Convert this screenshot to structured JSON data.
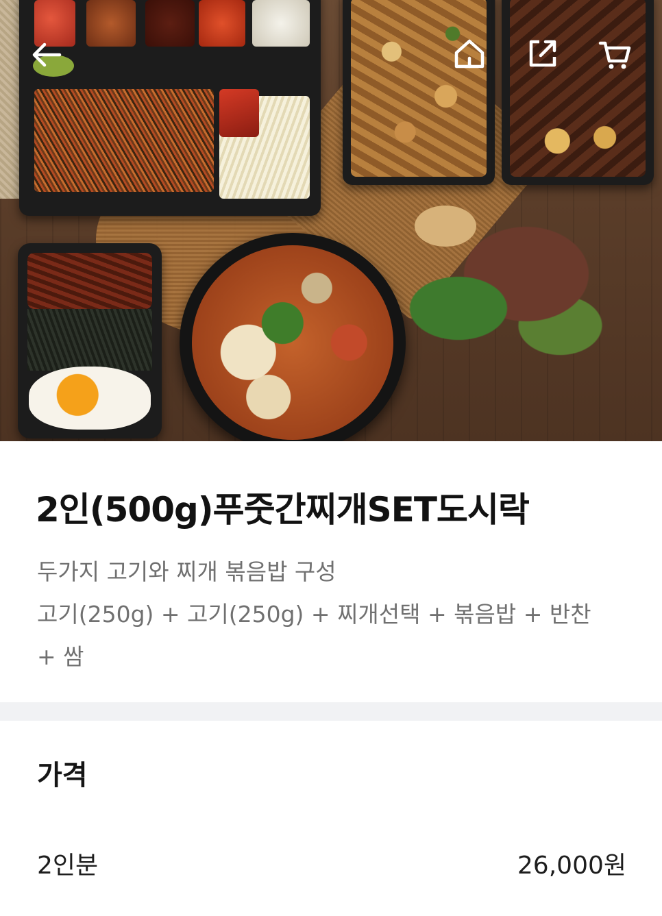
{
  "product": {
    "name": "2인(500g)푸줏간찌개SET도시락",
    "description_lines": [
      "두가지 고기와 찌개 볶음밥 구성",
      "고기(250g) + 고기(250g) + 찌개선택 + 볶음밥 + 반찬",
      "+ 쌈"
    ]
  },
  "header_icons": {
    "back": "back-arrow-icon",
    "home": "home-icon",
    "share": "share-icon",
    "cart": "cart-icon"
  },
  "price_section": {
    "heading": "가격",
    "options": [
      {
        "label": "2인분",
        "price": "26,000원"
      }
    ]
  },
  "colors": {
    "text_primary": "#121212",
    "text_secondary": "#707070",
    "divider": "#f1f2f4",
    "overlay_icon": "#ffffff"
  }
}
